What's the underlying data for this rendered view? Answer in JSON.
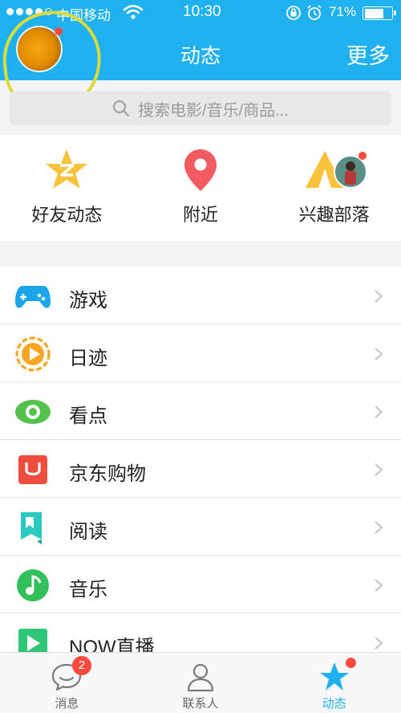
{
  "status_bar": {
    "carrier": "中国移动",
    "time": "10:30",
    "battery": "71%",
    "battery_level": 0.71
  },
  "header": {
    "title": "动态",
    "more_label": "更多",
    "accent_color": "#1fb0f0"
  },
  "search": {
    "placeholder": "搜索电影/音乐/商品..."
  },
  "quick_items": [
    {
      "label": "好友动态",
      "icon": "star-icon"
    },
    {
      "label": "附近",
      "icon": "location-pin-icon"
    },
    {
      "label": "兴趣部落",
      "icon": "tent-icon"
    }
  ],
  "menu": [
    {
      "label": "游戏",
      "icon": "gamepad-icon"
    },
    {
      "label": "日迹",
      "icon": "play-circle-icon"
    },
    {
      "label": "看点",
      "icon": "eye-icon"
    },
    {
      "label": "京东购物",
      "icon": "shopping-bag-icon"
    },
    {
      "label": "阅读",
      "icon": "bookmark-icon"
    },
    {
      "label": "音乐",
      "icon": "music-note-icon"
    },
    {
      "label": "NOW直播",
      "icon": "live-play-icon"
    }
  ],
  "tabbar": {
    "messages_label": "消息",
    "messages_badge": "2",
    "contacts_label": "联系人",
    "moments_label": "动态"
  }
}
